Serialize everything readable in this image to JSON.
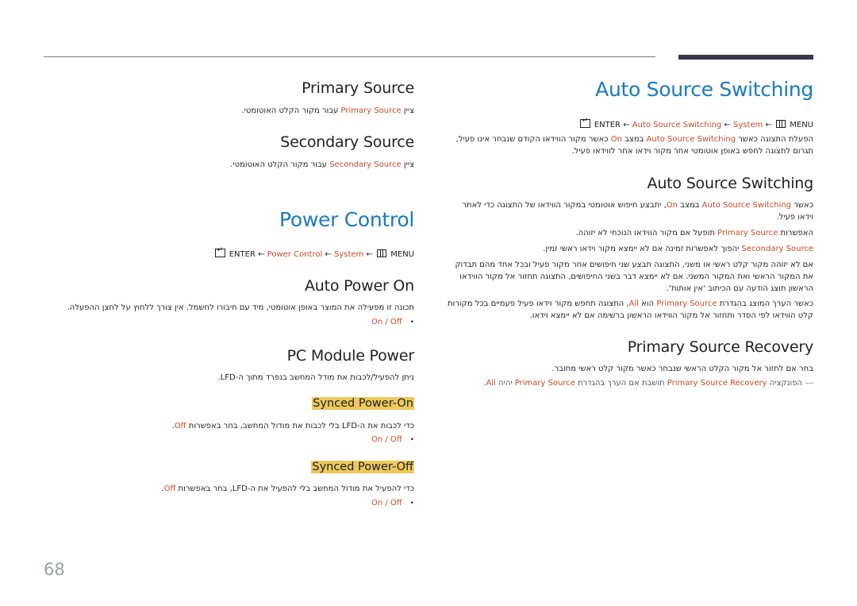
{
  "page_number": "68",
  "colors": {
    "accent_heading": "#1a7bc0",
    "highlight": "#c8492a",
    "subheading_bg": "#ecc95a",
    "rule_dark": "#3b3649"
  },
  "right": {
    "title": "Auto Source Switching",
    "path": {
      "enter": "ENTER",
      "arrow": "←",
      "items": [
        "Auto Source Switching",
        "System"
      ],
      "menu": "MENU"
    },
    "intro_line1": {
      "a": "הפעלת התצוגה כאשר ",
      "b": "Auto Source Switching",
      "c": " במצב ",
      "d": "On",
      "e": " כאשר מקור הווידאו הקודם שנבחר אינו פעיל,"
    },
    "intro_line2": "תגרום לתצוגה לחפש באופן אוטומטי אחר מקור וידאו אחר לווידאו פעיל.",
    "sub1": {
      "heading": "Auto Source Switching",
      "p1": {
        "a": "כאשר ",
        "b": "Auto Source Switching",
        "c": " במצב ",
        "d": "On",
        "e": ", יתבצע חיפוש אוטומטי במקור הווידאו של התצוגה כדי לאתר וידאו פעיל."
      },
      "p2": {
        "a": "האפשרות ",
        "b": "Primary Source",
        "c": " תופעל אם מקור הווידאו הנוכחי לא יזוהה."
      },
      "p3": {
        "a": "",
        "b": "Secondary Source",
        "c": " יהפוך לאפשרות זמינה אם לא יימצא מקור וידאו ראשי זמין."
      },
      "p4": "אם לא יזוהה מקור קלט ראשי או משני, התצוגה תבצע שני חיפושים אחר מקור פעיל ובכל אחד מהם תבדוק את המקור הראשי ואת המקור המשני. אם לא יימצא דבר בשני החיפושים, התצוגה תחזור אל מקור הווידאו הראשון תוצג הודעה עם הכיתוב 'אין אותות'.",
      "p5": {
        "a": "כאשר הערך המוצג בהגדרת ",
        "b": "Primary Source",
        "c": " הוא ",
        "d": "All",
        "e": ", התצוגה תחפש מקור וידאו פעיל פעמיים בכל מקורות קלט הווידאו לפי הסדר ותחזור אל מקור הווידאו הראשון ברשימה אם לא יימצא וידאו."
      }
    },
    "sub2": {
      "heading": "Primary Source Recovery",
      "p1": "בחר אם לחזור אל מקור הקלט הראשי שנבחר כאשר מקור קלט ראשי מחובר.",
      "note": {
        "dash": "―",
        "a": "הפונקציה ",
        "b": "Primary Source Recovery",
        "c": " תושבת אם הערך בהגדרת ",
        "d": "Primary Source",
        "e": " יהיה ",
        "f": "All",
        "g": "."
      }
    }
  },
  "left": {
    "primary": {
      "heading": "Primary Source",
      "p": {
        "a": "ציין ",
        "b": "Primary Source",
        "c": " עבור מקור הקלט האוטומטי."
      }
    },
    "secondary": {
      "heading": "Secondary Source",
      "p": {
        "a": "ציין ",
        "b": "Secondary Source",
        "c": " עבור מקור הקלט האוטומטי."
      }
    },
    "power_title": "Power Control",
    "path": {
      "enter": "ENTER",
      "arrow": "←",
      "items": [
        "Power Control",
        "System"
      ],
      "menu": "MENU"
    },
    "auto_power": {
      "heading": "Auto Power On",
      "p": "תכונה זו מפעילה את המוצר באופן אוטומטי, מיד עם חיבורו לחשמל. אין צורך ללחוץ על לחצן ההפעלה.",
      "option": {
        "on": "On",
        "sep": " / ",
        "off": "Off"
      }
    },
    "pc_module": {
      "heading": "PC Module Power",
      "p": "ניתן להפעיל/לכבות את מודל המחשב בנפרד מתוך ה-LFD."
    },
    "synced_on": {
      "heading": "Synced Power-On",
      "p": {
        "a": "כדי לכבות את ה-LFD בלי לכבות את מודול המחשב, בחר באפשרות ",
        "b": "Off",
        "c": "."
      },
      "option": {
        "on": "On",
        "sep": " / ",
        "off": "Off"
      }
    },
    "synced_off": {
      "heading": "Synced Power-Off",
      "p": {
        "a": "כדי להפעיל את מודול המחשב בלי להפעיל את ה-LFD, בחר באפשרות ",
        "b": "Off",
        "c": "."
      },
      "option": {
        "on": "On",
        "sep": " / ",
        "off": "Off"
      }
    }
  },
  "icons": {
    "enter": "enter-key-icon",
    "menu": "menu-grid-icon",
    "bullet": "bullet-dot-icon",
    "note": "note-dash-icon"
  }
}
